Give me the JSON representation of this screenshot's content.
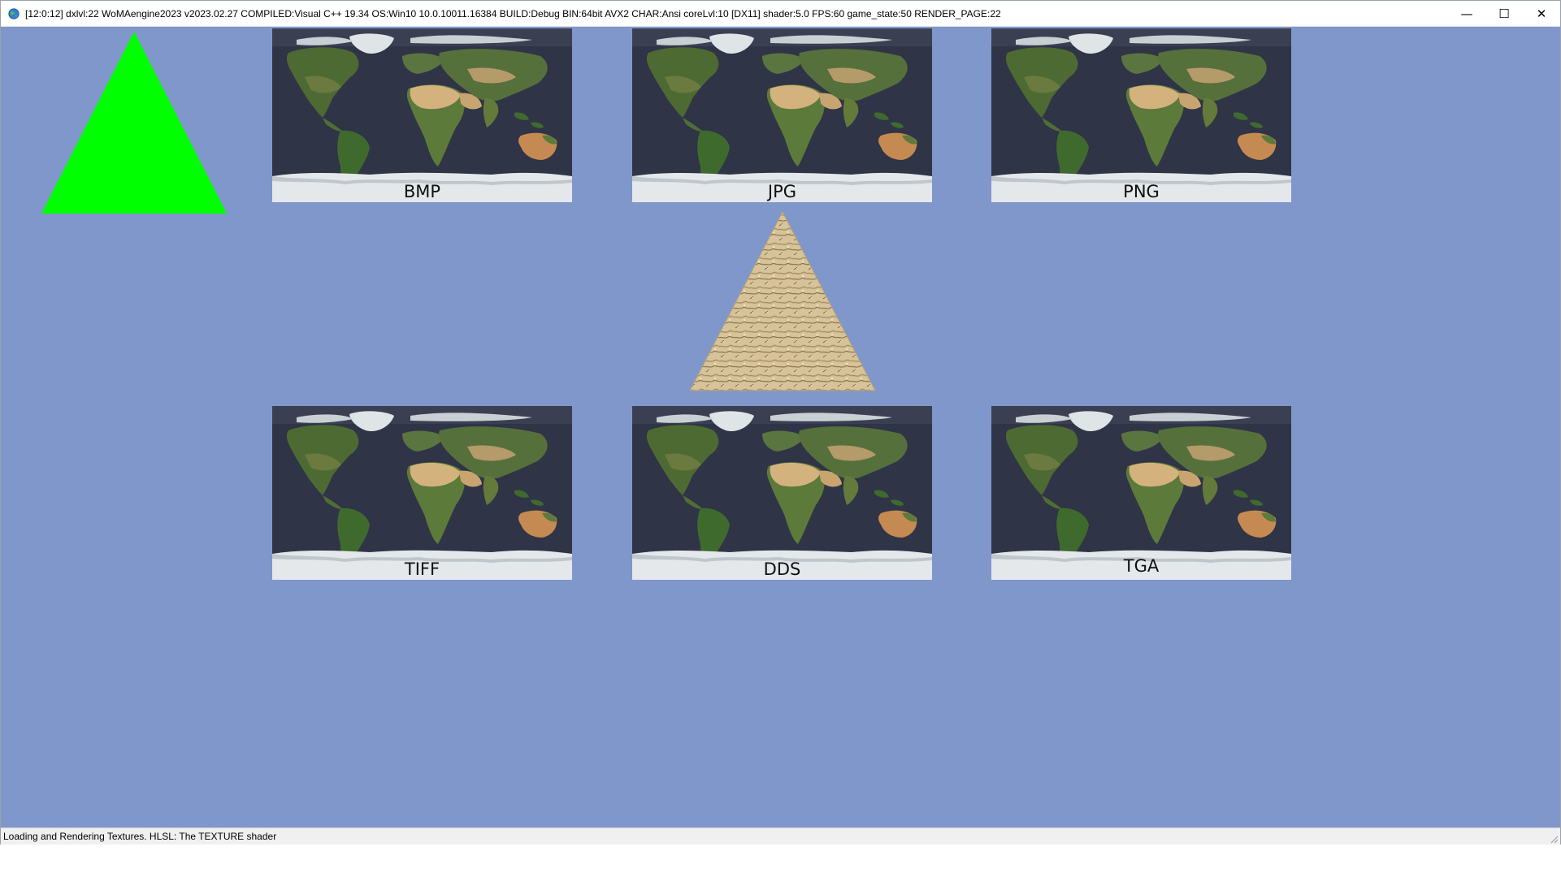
{
  "window": {
    "title": "[12:0:12] dxlvl:22 WoMAengine2023 v2023.02.27 COMPILED:Visual C++ 19.34 OS:Win10 10.0.10011.16384 BUILD:Debug BIN:64bit AVX2 CHAR:Ansi coreLvl:10 [DX11] shader:5.0 FPS:60 game_state:50 RENDER_PAGE:22",
    "minimize": "—",
    "maximize": "☐",
    "close": "✕"
  },
  "colors": {
    "viewport_bg": "#7f97cb",
    "green_triangle": "#00ff00",
    "ocean": "#2f3446",
    "land": "#4d6a33",
    "desert": "#c9aa78",
    "ice": "#e4e8ea"
  },
  "textures": [
    {
      "label": "BMP"
    },
    {
      "label": "JPG"
    },
    {
      "label": "PNG"
    },
    {
      "label": "TIFF"
    },
    {
      "label": "DDS"
    },
    {
      "label": "TGA"
    }
  ],
  "status": {
    "text": "Loading and Rendering Textures. HLSL: The TEXTURE shader"
  }
}
